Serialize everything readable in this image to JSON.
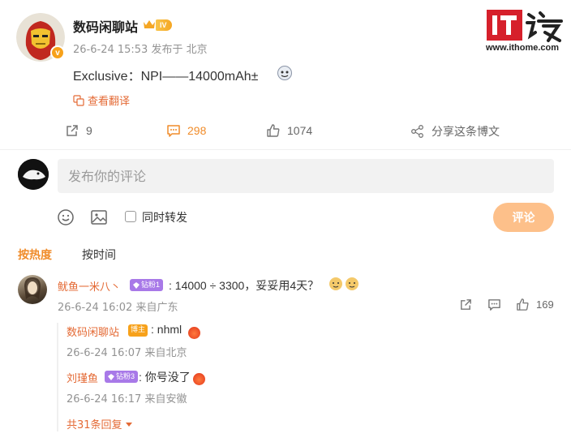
{
  "post": {
    "author": "数码闲聊站",
    "level": "IV",
    "verified_mark": "v",
    "meta": "26-6-24 15:53  发布于 北京",
    "text": "Exclusive：NPI——14000mAh±",
    "translate_label": "查看翻译",
    "emoji_icon": "doge-face-icon"
  },
  "watermark": {
    "logo_text": "IT之家",
    "url": "www.ithome.com"
  },
  "actions": {
    "repost_count": "9",
    "comment_count": "298",
    "like_count": "1074",
    "share_label": "分享这条博文"
  },
  "composer": {
    "placeholder": "发布你的评论",
    "repost_label": "同时转发",
    "submit_label": "评论"
  },
  "sort": {
    "hot": "按热度",
    "time": "按时间"
  },
  "comment": {
    "author": "鱿鱼一米八丶",
    "badge": "钻粉1",
    "text": ": 14000 ÷ 3300，妥妥用4天？",
    "meta": "26-6-24 16:02  来自广东",
    "like_count": "169"
  },
  "replies": [
    {
      "author": "数码闲聊站",
      "badge": "博主",
      "text": ": nhml",
      "meta": "26-6-24 16:07  来自北京"
    },
    {
      "author": "刘瑾鱼",
      "badge": "钻粉3",
      "text": ": 你号没了",
      "meta": "26-6-24 16:17  来自安徽"
    }
  ],
  "more_replies_label": "共31条回复",
  "colors": {
    "accent": "#f08c2a",
    "name": "#e46a35",
    "logo_red": "#d6202b"
  }
}
